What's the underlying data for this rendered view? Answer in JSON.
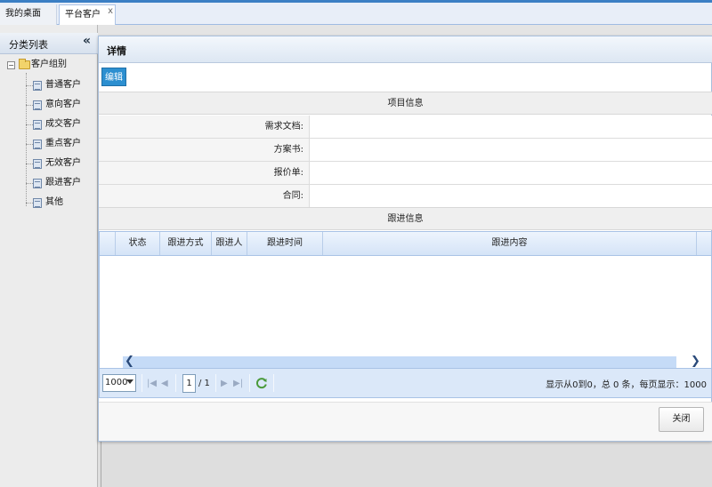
{
  "tabs": [
    {
      "label": "我的桌面",
      "active": false
    },
    {
      "label": "平台客户",
      "active": true,
      "close": "x"
    }
  ],
  "sidebar": {
    "title": "分类列表",
    "collapse_glyph": "«",
    "root": {
      "label": "客户组别",
      "expander": "−"
    },
    "items": [
      {
        "label": "普通客户"
      },
      {
        "label": "意向客户"
      },
      {
        "label": "成交客户"
      },
      {
        "label": "重点客户"
      },
      {
        "label": "无效客户"
      },
      {
        "label": "跟进客户"
      },
      {
        "label": "其他"
      }
    ]
  },
  "dialog": {
    "title": "详情",
    "edit_label": "编辑",
    "project_section": "项目信息",
    "fields": [
      {
        "label": "需求文档:",
        "value": ""
      },
      {
        "label": "方案书:",
        "value": ""
      },
      {
        "label": "报价单:",
        "value": ""
      },
      {
        "label": "合同:",
        "value": ""
      }
    ],
    "followup_section": "跟进信息",
    "grid": {
      "columns": [
        "",
        "状态",
        "跟进方式",
        "跟进人",
        "跟进时间",
        "跟进内容"
      ],
      "rows": []
    },
    "pager": {
      "page_size": "1000",
      "current_page": "1",
      "total_pages": "/ 1",
      "info": "显示从0到0，总 0 条，每页显示：1000"
    },
    "close_label": "关闭"
  },
  "colors": {
    "accent": "#3b7fc4",
    "edit_button": "#2c8fd0",
    "grid_header": "#d5e4f7",
    "pager_bg": "#dbe8f9"
  }
}
